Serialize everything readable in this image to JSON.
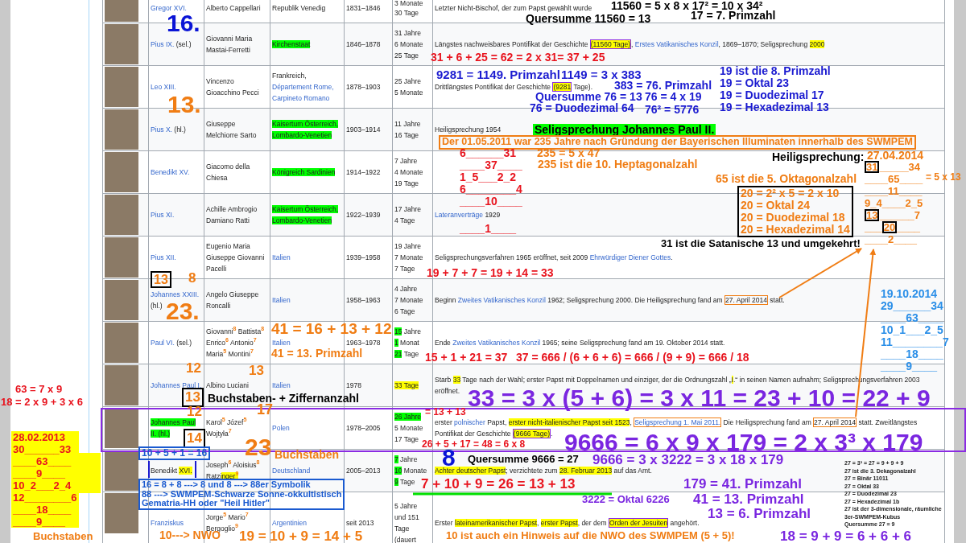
{
  "table": {
    "rows": [
      {
        "name": [
          {
            "text": "Gregor XVI.",
            "kind": "link"
          }
        ],
        "birth_name": [
          {
            "text": "Alberto Cappellari",
            "kind": "text"
          }
        ],
        "country": [
          {
            "text": "Republik Venedig",
            "kind": "text"
          }
        ],
        "years": "1831–1846",
        "duration": [
          [
            {
              "text": "3 Monate",
              "kind": "text"
            }
          ],
          [
            {
              "text": "30 Tage",
              "kind": "text"
            }
          ]
        ],
        "remarks": [
          {
            "text": "Letzter Nicht-Bischof, der zum Papst gewählt wurde",
            "kind": "text"
          }
        ]
      },
      {
        "name": [
          {
            "text": "Pius IX.",
            "kind": "link"
          },
          {
            "text": " (sel.)",
            "kind": "text"
          }
        ],
        "birth_name": [
          {
            "text": "Giovanni Maria Mastai-Ferretti",
            "kind": "text"
          }
        ],
        "country": [
          {
            "text": "Kirchenstaat",
            "kind": "green"
          }
        ],
        "years": "1846–1878",
        "duration": [
          [
            {
              "text": "31 Jahre",
              "kind": "text"
            }
          ],
          [
            {
              "text": "6 Monate",
              "kind": "text"
            }
          ],
          [
            {
              "text": "25 Tage",
              "kind": "text"
            }
          ]
        ],
        "remarks": [
          {
            "text": "Längstes nachweisbares Pontifikat der Geschichte ",
            "kind": "text"
          },
          {
            "text": "(11560 Tage)",
            "kind": "boxedmark"
          },
          {
            "text": ", ",
            "kind": "text"
          },
          {
            "text": "Erstes Vatikanisches Konzil",
            "kind": "link"
          },
          {
            "text": ", 1869–1870; Seligsprechung ",
            "kind": "text"
          },
          {
            "text": "2000",
            "kind": "yellow"
          }
        ]
      },
      {
        "name": [
          {
            "text": "Leo XIII.",
            "kind": "link"
          }
        ],
        "birth_name": [
          {
            "text": "Vincenzo Gioacchino Pecci",
            "kind": "text"
          }
        ],
        "country": [
          {
            "text": "Frankreich,",
            "kind": "text"
          },
          {
            "text": "Département Rome,",
            "kind": "link"
          },
          {
            "text": "Carpineto Romano",
            "kind": "link"
          }
        ],
        "years": "1878–1903",
        "duration": [
          [
            {
              "text": "25 Jahre",
              "kind": "text"
            }
          ],
          [
            {
              "text": "5 Monate",
              "kind": "text"
            }
          ]
        ],
        "remarks": [
          {
            "text": "Drittlängstes Pontifikat der Geschichte ",
            "kind": "text"
          },
          {
            "text": "(9281",
            "kind": "boxedmark"
          },
          {
            "text": " Tage).",
            "kind": "text"
          }
        ]
      },
      {
        "name": [
          {
            "text": "Pius X.",
            "kind": "link"
          },
          {
            "text": " (hl.)",
            "kind": "text"
          }
        ],
        "birth_name": [
          {
            "text": "Giuseppe Melchiorre Sarto",
            "kind": "text"
          }
        ],
        "country": [
          {
            "text": "Kaisertum Österreich,",
            "kind": "green"
          },
          {
            "text": "Lombardo-Venetien",
            "kind": "green"
          }
        ],
        "years": "1903–1914",
        "duration": [
          [
            {
              "text": "11 Jahre",
              "kind": "text"
            }
          ],
          [
            {
              "text": "16 Tage",
              "kind": "text"
            }
          ]
        ],
        "remarks": [
          {
            "text": "Heiligsprechung 1954",
            "kind": "text"
          }
        ]
      },
      {
        "name": [
          {
            "text": "Benedikt XV.",
            "kind": "link"
          }
        ],
        "birth_name": [
          {
            "text": "Giacomo della Chiesa",
            "kind": "text"
          }
        ],
        "country": [
          {
            "text": "Königreich Sardinien",
            "kind": "green"
          }
        ],
        "years": "1914–1922",
        "duration": [
          [
            {
              "text": "7 Jahre",
              "kind": "text"
            }
          ],
          [
            {
              "text": "4 Monate",
              "kind": "text"
            }
          ],
          [
            {
              "text": "19 Tage",
              "kind": "text"
            }
          ]
        ]
      },
      {
        "name": [
          {
            "text": "Pius XI.",
            "kind": "link"
          }
        ],
        "birth_name": [
          {
            "text": "Achille Ambrogio Damiano Ratti",
            "kind": "text"
          }
        ],
        "country": [
          {
            "text": "Kaisertum Österreich,",
            "kind": "green"
          },
          {
            "text": "Lombardo-Venetien",
            "kind": "green"
          }
        ],
        "years": "1922–1939",
        "duration": [
          [
            {
              "text": "17 Jahre",
              "kind": "text"
            }
          ],
          [
            {
              "text": "4 Tage",
              "kind": "text"
            }
          ]
        ],
        "remarks": [
          {
            "text": "Lateranverträge",
            "kind": "link"
          },
          {
            "text": " 1929",
            "kind": "text"
          }
        ]
      },
      {
        "name": [
          {
            "text": "Pius XII.",
            "kind": "link"
          }
        ],
        "birth_name": [
          {
            "text": "Eugenio Maria Giuseppe Giovanni Pacelli",
            "kind": "text"
          }
        ],
        "country": [
          {
            "text": "Italien",
            "kind": "link"
          }
        ],
        "years": "1939–1958",
        "duration": [
          [
            {
              "text": "19 Jahre",
              "kind": "text"
            }
          ],
          [
            {
              "text": "7 Monate",
              "kind": "text"
            }
          ],
          [
            {
              "text": "7 Tage",
              "kind": "text"
            }
          ]
        ],
        "remarks": [
          {
            "text": "Seligsprechungsverfahren 1965 eröffnet, seit 2009 ",
            "kind": "text"
          },
          {
            "text": "Ehrwürdiger Diener Gottes",
            "kind": "link"
          },
          {
            "text": ".",
            "kind": "text"
          }
        ]
      },
      {
        "name": [
          {
            "text": "Johannes XXIII.",
            "kind": "link"
          },
          {
            "text": " (hl.)",
            "kind": "text"
          }
        ],
        "birth_name": [
          {
            "text": "Angelo Giuseppe Roncalli",
            "kind": "text"
          }
        ],
        "country": [
          {
            "text": "Italien",
            "kind": "link"
          }
        ],
        "years": "1958–1963",
        "duration": [
          [
            {
              "text": "4 Jahre",
              "kind": "text"
            }
          ],
          [
            {
              "text": "7 Monate",
              "kind": "text"
            }
          ],
          [
            {
              "text": "6 Tage",
              "kind": "text"
            }
          ]
        ],
        "remarks": [
          {
            "text": "Beginn ",
            "kind": "text"
          },
          {
            "text": "Zweites Vatikanisches Konzil",
            "kind": "link"
          },
          {
            "text": " 1962; Seligsprechung 2000. Die Heiligsprechung fand am ",
            "kind": "text"
          },
          {
            "text": "27. April 2014",
            "kind": "boxed"
          },
          {
            "text": " statt.",
            "kind": "text"
          }
        ]
      },
      {
        "name": [
          {
            "text": "Paul VI.",
            "kind": "link"
          },
          {
            "text": " (sel.)",
            "kind": "text"
          }
        ],
        "birth_name": [
          {
            "text": "Giovanni$^{8}$ Battista$^{8}$ Enrico$^{6}$ Antonio$^{7}$ Maria$^{5}$ Montini$^{7}$",
            "kind": "text"
          }
        ],
        "country": [
          {
            "text": "Italien",
            "kind": "link"
          }
        ],
        "years": "1963–1978",
        "duration": [
          [
            {
              "text": "15",
              "kind": "green"
            },
            {
              "text": " Jahre",
              "kind": "text"
            }
          ],
          [
            {
              "text": "1",
              "kind": "green"
            },
            {
              "text": " Monat",
              "kind": "text"
            }
          ],
          [
            {
              "text": "21",
              "kind": "green"
            },
            {
              "text": " Tage",
              "kind": "text"
            }
          ]
        ],
        "remarks": [
          {
            "text": "Ende ",
            "kind": "text"
          },
          {
            "text": "Zweites Vatikanisches Konzil",
            "kind": "link"
          },
          {
            "text": " 1965; seine Seligsprechung fand am 19. Oktober 2014 statt.",
            "kind": "text"
          }
        ]
      },
      {
        "name": [
          {
            "text": "Johannes Paul I.",
            "kind": "link"
          }
        ],
        "birth_name": [
          {
            "text": "Albino Luciani",
            "kind": "text"
          }
        ],
        "country": [
          {
            "text": "Italien",
            "kind": "link"
          }
        ],
        "years": "1978",
        "duration": [
          [
            {
              "text": "33 Tage",
              "kind": "yellow"
            }
          ]
        ],
        "remarks": [
          {
            "text": "Starb ",
            "kind": "text"
          },
          {
            "text": "33",
            "kind": "yellow"
          },
          {
            "text": " Tage nach der Wahl; erster Papst mit Doppelnamen und einziger, der die Ordnungszahl „",
            "kind": "text"
          },
          {
            "text": "I",
            "kind": "yellow"
          },
          {
            "text": ".“ in seinen Namen aufnahm; Seligsprechungsverfahren 2003 eröffnet.",
            "kind": "text"
          }
        ]
      },
      {
        "name": [
          {
            "text": "Johannes Paul II. (hl.)",
            "kind": "green"
          }
        ],
        "birth_name": [
          {
            "text": "Karol$^{5}$ Józef$^{5}$ Wojtyła$^{7}$",
            "kind": "text"
          }
        ],
        "country": [
          {
            "text": "Polen",
            "kind": "link"
          }
        ],
        "years": "1978–2005",
        "duration": [
          [
            {
              "text": "26 Jahre",
              "kind": "green"
            }
          ],
          [
            {
              "text": "5 Monate",
              "kind": "text"
            }
          ],
          [
            {
              "text": "17 Tage",
              "kind": "text"
            }
          ]
        ],
        "remarks": [
          {
            "text": "erster ",
            "kind": "text"
          },
          {
            "text": "polnischer",
            "kind": "link"
          },
          {
            "text": " Papst, ",
            "kind": "text"
          },
          {
            "text": "erster nicht-italienischer Papst seit 1523",
            "kind": "yellow"
          },
          {
            "text": ", ",
            "kind": "text"
          },
          {
            "text": "Seligsprechung 1. Mai 2011.",
            "kind": "boxedlink"
          },
          {
            "text": " Die Heiligsprechung fand am ",
            "kind": "text"
          },
          {
            "text": "27. April 2014",
            "kind": "boxed"
          },
          {
            "text": " statt. Zweitlängstes Pontifikat der Geschichte ",
            "kind": "text"
          },
          {
            "text": "(9666 Tage)",
            "kind": "boxedmark"
          },
          {
            "text": ".",
            "kind": "text"
          }
        ]
      },
      {
        "name": [
          {
            "text": "Benedikt ",
            "kind": "text"
          },
          {
            "text": "XVI.",
            "kind": "yellow"
          }
        ],
        "birth_name": [
          {
            "text": "Joseph$^{6}$ Aloisius$^{8}$ Ratzi",
            "kind": "text"
          },
          {
            "text": "nger$^{9}$",
            "kind": "yellow"
          }
        ],
        "country": [
          {
            "text": "Deutschland",
            "kind": "link"
          }
        ],
        "years": "2005–2013",
        "duration": [
          [
            {
              "text": "7",
              "kind": "green"
            },
            {
              "text": " Jahre",
              "kind": "text"
            }
          ],
          [
            {
              "text": "10",
              "kind": "green"
            },
            {
              "text": " Monate",
              "kind": "text"
            }
          ],
          [
            {
              "text": "9",
              "kind": "green"
            },
            {
              "text": " Tage",
              "kind": "text"
            }
          ]
        ],
        "remarks": [
          {
            "text": "Achter deutscher Papst",
            "kind": "yellow"
          },
          {
            "text": "; verzichtete zum ",
            "kind": "text"
          },
          {
            "text": "28. Februar 2013",
            "kind": "yellow"
          },
          {
            "text": " auf das Amt.",
            "kind": "text"
          }
        ]
      },
      {
        "name": [
          {
            "text": "Franziskus",
            "kind": "link"
          }
        ],
        "birth_name": [
          {
            "text": "Jorge$^{5}$ Mario$^{7}$ Bergoglio$^{9}$",
            "kind": "text"
          }
        ],
        "country": [
          {
            "text": "Argentinien",
            "kind": "link"
          }
        ],
        "years": "seit 2013",
        "duration": [
          [
            {
              "text": "5 Jahre",
              "kind": "text"
            }
          ],
          [
            {
              "text": "und 151",
              "kind": "text"
            }
          ],
          [
            {
              "text": "Tage",
              "kind": "text"
            }
          ],
          [
            {
              "text": "(dauert",
              "kind": "text"
            }
          ]
        ],
        "remarks": [
          {
            "text": "Erster ",
            "kind": "text"
          },
          {
            "text": "lateinamerikanischer Papst",
            "kind": "yellow"
          },
          {
            "text": ", ",
            "kind": "text"
          },
          {
            "text": "erster Papst",
            "kind": "yellow"
          },
          {
            "text": ", der dem ",
            "kind": "text"
          },
          {
            "text": "Orden der Jesuiten",
            "kind": "boxedmark"
          },
          {
            "text": " angehört.",
            "kind": "text"
          }
        ]
      }
    ]
  },
  "annotations": [
    {
      "text": "16.",
      "color": "#0a14d6",
      "kind": "plain"
    },
    {
      "text": "11560 = 5 x 8 x 17² = 10 x 34²",
      "color": "#000000",
      "kind": "plain"
    },
    {
      "text": "Quersumme 11560 = 13",
      "color": "#000000",
      "kind": "plain"
    },
    {
      "text": "17 = 7. Primzahl",
      "color": "#000000",
      "kind": "plain"
    },
    {
      "text": "31 + 6 + 25 = 62 = 2 x 31= 37 + 25",
      "color": "#e8141e",
      "kind": "plain"
    },
    {
      "text": "13.",
      "color": "#f07d14",
      "kind": "plain"
    },
    {
      "text": "9281 = 1149. Primzahl",
      "color": "#1a1ad0",
      "kind": "plain"
    },
    {
      "text": "1149 = 3 x 383",
      "color": "#1a1ad0",
      "kind": "plain"
    },
    {
      "text": "Quersumme 76 = 13",
      "color": "#1a1ad0",
      "kind": "plain"
    },
    {
      "text": "76 = Duodezimal 64",
      "color": "#1a1ad0",
      "kind": "plain"
    },
    {
      "text": "383 = 76. Primzahl",
      "color": "#1a1ad0",
      "kind": "plain"
    },
    {
      "text": "76 = 4 x 19",
      "color": "#1a1ad0",
      "kind": "plain"
    },
    {
      "text": "76² = 5776",
      "color": "#1a1ad0",
      "kind": "plain"
    },
    {
      "text": "19 ist die 8. Primzahl\n19 = Oktal 23\n19 = Duodezimal 17\n19 = Hexadezimal 13",
      "color": "#1a1ad0",
      "kind": "plain"
    },
    {
      "text": "Seligsprechung Johannes Paul II.",
      "kind": "greenmark"
    },
    {
      "text": "Der 01.05.2011 war 235 Jahre nach Gründung der Bayerischen Illuminaten innerhalb des SWMPEM",
      "color": "#f07d14",
      "kind": "outlined"
    },
    {
      "text": "6______31\n____37____\n1_5___2_2\n6________4\n____10____",
      "color": "#e8141e",
      "kind": "plain"
    },
    {
      "text": "____1____",
      "color": "#e8141e",
      "kind": "plain"
    },
    {
      "text": "235 = 5 x 47",
      "color": "#f07d14",
      "kind": "plain"
    },
    {
      "text": "235 ist die 10. Heptagonalzahl",
      "color": "#f07d14",
      "kind": "plain"
    },
    {
      "text": "Heiligsprechung:",
      "color": "#000000",
      "kind": "plain"
    },
    {
      "text": "65 ist die 5. Oktagonalzahl",
      "color": "#f07d14",
      "kind": "plain"
    },
    {
      "text": "20 = 2² x 5 = 2 x 10\n20 = Oktal 24\n20 = Duodezimal 18\n20 = Hexadezimal 14",
      "color": "#f07d14",
      "kind": "boxed"
    },
    {
      "text": "31 ist die Satanische 13 und umgekehrt!",
      "color": "#000000",
      "kind": "plain"
    },
    {
      "text": "27.04.2014",
      "color": "#f07d14",
      "kind": "plain"
    },
    {
      "lines": [
        [
          {
            "text": "31",
            "kind": "boxed"
          },
          {
            "text": "_____34",
            "kind": "plain"
          }
        ],
        [
          {
            "text": "____65____",
            "kind": "plain"
          }
        ],
        [
          {
            "text": "____11____",
            "kind": "plain"
          }
        ],
        [
          {
            "text": "9_4____2_5",
            "kind": "plain"
          }
        ],
        [
          {
            "text": "13",
            "kind": "boxed"
          },
          {
            "text": "______7",
            "kind": "plain"
          }
        ],
        [
          {
            "text": "___",
            "kind": "plain"
          },
          {
            "text": "20",
            "kind": "boxed"
          },
          {
            "text": "____",
            "kind": "plain"
          }
        ],
        [
          {
            "text": "____2____",
            "kind": "plain"
          }
        ]
      ],
      "color": "#f07d14",
      "kind": "plain"
    },
    {
      "text": "= 5 x 13",
      "color": "#f07d14",
      "kind": "plain"
    },
    {
      "text": "13",
      "color": "#f07d14",
      "kind": "boxed"
    },
    {
      "text": "8",
      "color": "#f07d14",
      "kind": "plain"
    },
    {
      "text": "19 + 7 + 7 = 19 + 14 = 33",
      "color": "#e8141e",
      "kind": "plain"
    },
    {
      "text": "23.",
      "color": "#f07d14",
      "kind": "plain"
    },
    {
      "text": "41 = 16 + 13 + 12",
      "color": "#f07d14",
      "kind": "plain"
    },
    {
      "text": "41 = 13. Primzahl",
      "color": "#f07d14",
      "kind": "plain"
    },
    {
      "text": "15 + 1 + 21 = 37",
      "color": "#e8141e",
      "kind": "plain"
    },
    {
      "text": "37 = 666 / (6 + 6 + 6) = 666 / (9 + 9) = 666 / 18",
      "color": "#e8141e",
      "kind": "plain"
    },
    {
      "text": "12",
      "color": "#f07d14",
      "kind": "plain"
    },
    {
      "text": "13",
      "color": "#f07d14",
      "kind": "plain"
    },
    {
      "text": "19.10.2014\n29______34\n____63____\n10_1___2_5\n11________7\n____18____\n____9____",
      "color": "#2b8fe8",
      "kind": "plain"
    },
    {
      "text": "63 = 7 x 9",
      "color": "#e8141e",
      "kind": "plain"
    },
    {
      "text": "18 = 2 x 9 + 3 x 6",
      "color": "#e8141e",
      "kind": "plain"
    },
    {
      "text": "13",
      "color": "#f07d14",
      "kind": "boxed"
    },
    {
      "text": "Buchstaben- + Ziffernanzahl",
      "color": "#000000",
      "kind": "plain"
    },
    {
      "text": "12",
      "color": "#f07d14",
      "kind": "plain"
    },
    {
      "text": "17",
      "color": "#f07d14",
      "kind": "plain"
    },
    {
      "text": "= 13 + 13",
      "color": "#e8141e",
      "kind": "plain"
    },
    {
      "text": "33 = 3 x (5 + 6) = 3 x 11 = 23 + 10 = 22 + 9",
      "color": "#7a26e0",
      "kind": "plain"
    },
    {
      "text": "28.02.2013\n30______33\n____63____\n____9____\n10_2___2_4\n12________6\n____18____\n____9____",
      "color": "#e8141e",
      "kind": "yellowmark"
    },
    {
      "text": "14",
      "color": "#f07d14",
      "kind": "boxed"
    },
    {
      "text": "10 + 5 + 1 = 16",
      "color": "#1a5ad0",
      "kind": "outlined"
    },
    {
      "text": "23",
      "color": "#f07d14",
      "kind": "plain"
    },
    {
      "text": "Buchstaben",
      "color": "#f07d14",
      "kind": "plain"
    },
    {
      "text": "26 + 5 + 17 = 48 = 6 x 8",
      "color": "#e8141e",
      "kind": "plain"
    },
    {
      "text": "8",
      "color": "#0a14d6",
      "kind": "plain"
    },
    {
      "text": "Quersumme 9666 = 27",
      "color": "#000000",
      "kind": "plain"
    },
    {
      "text": "9666 = 6 x 9 x 179 = 2 x 3³ x 179",
      "color": "#7a26e0",
      "kind": "plain"
    },
    {
      "text": "9666 = 3 x 3222 = 3 x 18 x 179",
      "color": "#7a26e0",
      "kind": "plain"
    },
    {
      "text": "16 = 8 + 8 ---> 8 und 8 ---> 88er Symbolik\n88 ---> SWMPEM-Schwarze Sonne-okkultistisch\nGematria-HH oder \"Heil Hitler\"",
      "color": "#1a5ad0",
      "kind": "outlined"
    },
    {
      "text": "7 + 10 + 9 = 26 = 13 + 13",
      "color": "#e8141e",
      "kind": "plain"
    },
    {
      "text": "3222 = Oktal 6226",
      "color": "#7a26e0",
      "kind": "plain"
    },
    {
      "text": "179 = 41. Primzahl",
      "color": "#7a26e0",
      "kind": "plain"
    },
    {
      "text": "41 = 13. Primzahl",
      "color": "#7a26e0",
      "kind": "plain"
    },
    {
      "text": "13 = 6. Primzahl",
      "color": "#7a26e0",
      "kind": "plain"
    },
    {
      "text": "Buchstaben",
      "color": "#f07d14",
      "kind": "plain"
    },
    {
      "text": "10---> NWO",
      "color": "#f07d14",
      "kind": "plain"
    },
    {
      "text": "19 = 10 + 9 = 14 + 5",
      "color": "#f07d14",
      "kind": "plain"
    },
    {
      "text": "10 ist auch ein Hinweis auf die NWO des SWMPEM (5 + 5)!",
      "color": "#f07d14",
      "kind": "plain"
    },
    {
      "text": "27 = 3³ = 27 = 9 + 9 + 9\n27 ist die 3. Dekagonalzahl\n27 = Binär 11011\n27 = Oktal 33\n27 = Duodezimal 23\n27 = Hexadezimal 1b\n27 ist der 3-dimensionale, räumliche\n3er-SWMPEM-Kubus\nQuersumme 27 = 9",
      "color": "#222222",
      "kind": "plain"
    },
    {
      "text": "18 = 9 + 9 = 6 + 6 + 6",
      "color": "#7a26e0",
      "kind": "plain"
    }
  ]
}
